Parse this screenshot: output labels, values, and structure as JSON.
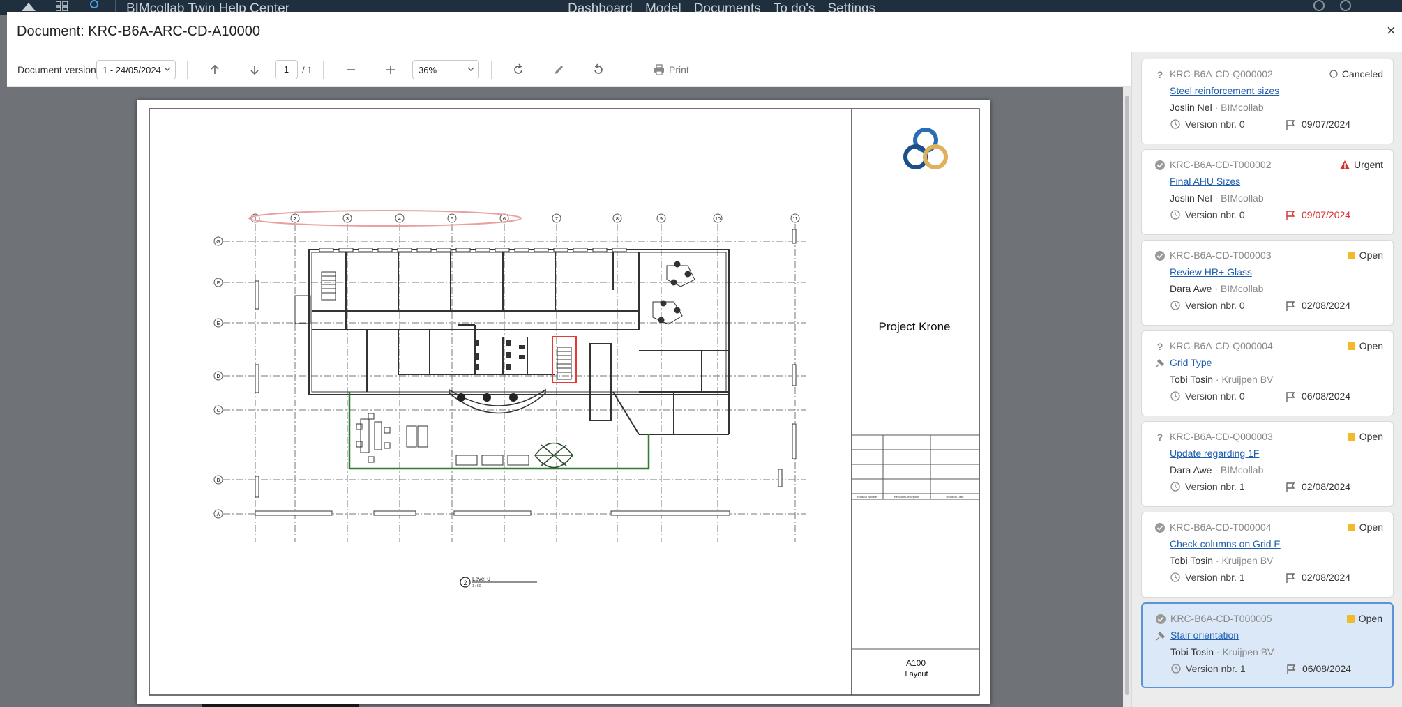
{
  "app": {
    "title": "BIMcollab Twin Help Center",
    "nav": [
      "Dashboard",
      "Model",
      "Documents",
      "To do's",
      "Settings"
    ]
  },
  "modal": {
    "title": "Document: KRC-B6A-ARC-CD-A10000",
    "close_glyph": "×"
  },
  "toolbar": {
    "version_label": "Document version",
    "version_value": "1 - 24/05/2024",
    "page_current": "1",
    "page_total": "/ 1",
    "zoom_value": "36%",
    "print_label": "Print"
  },
  "sheet": {
    "project_name": "Project Krone",
    "sheet_number": "A100",
    "sheet_name": "Layout",
    "view_number": "2",
    "view_title": "Level 0",
    "view_scale": "1 : 50",
    "grid_columns": [
      "1",
      "2",
      "3",
      "4",
      "5",
      "6",
      "7",
      "8",
      "9",
      "10",
      "11"
    ],
    "grid_rows": [
      "G",
      "F",
      "E",
      "D",
      "C",
      "B",
      "A"
    ],
    "revision_headers": [
      "Revision Number",
      "Revision Description",
      "Revision Date"
    ]
  },
  "issues": [
    {
      "code": "KRC-B6A-CD-Q000002",
      "title": "Steel reinforcement sizes",
      "assignee": "Joslin Nel",
      "org": "BIMcollab",
      "version": "Version nbr. 0",
      "due": "09/07/2024",
      "status": "Canceled",
      "type_icon": "question-icon",
      "status_icon": "circle-outline-icon",
      "overdue": false,
      "pinned": false
    },
    {
      "code": "KRC-B6A-CD-T000002",
      "title": "Final AHU Sizes",
      "assignee": "Joslin Nel",
      "org": "BIMcollab",
      "version": "Version nbr. 0",
      "due": "09/07/2024",
      "status": "Urgent",
      "type_icon": "check-circle-icon",
      "status_icon": "warning-triangle-icon",
      "overdue": true,
      "pinned": false
    },
    {
      "code": "KRC-B6A-CD-T000003",
      "title": "Review HR+ Glass",
      "assignee": "Dara Awe",
      "org": "BIMcollab",
      "version": "Version nbr. 0",
      "due": "02/08/2024",
      "status": "Open",
      "type_icon": "check-circle-icon",
      "status_icon": "yellow-square-icon",
      "overdue": false,
      "pinned": false
    },
    {
      "code": "KRC-B6A-CD-Q000004",
      "title": "Grid Type",
      "assignee": "Tobi Tosin",
      "org": "Kruijpen BV",
      "version": "Version nbr. 0",
      "due": "06/08/2024",
      "status": "Open",
      "type_icon": "question-icon",
      "status_icon": "yellow-square-icon",
      "overdue": false,
      "pinned": true
    },
    {
      "code": "KRC-B6A-CD-Q000003",
      "title": "Update regarding 1F",
      "assignee": "Dara Awe",
      "org": "BIMcollab",
      "version": "Version nbr. 1",
      "due": "02/08/2024",
      "status": "Open",
      "type_icon": "question-icon",
      "status_icon": "yellow-square-icon",
      "overdue": false,
      "pinned": false
    },
    {
      "code": "KRC-B6A-CD-T000004",
      "title": "Check columns on Grid E",
      "assignee": "Tobi Tosin",
      "org": "Kruijpen BV",
      "version": "Version nbr. 1",
      "due": "02/08/2024",
      "status": "Open",
      "type_icon": "check-circle-icon",
      "status_icon": "yellow-square-icon",
      "overdue": false,
      "pinned": false
    },
    {
      "code": "KRC-B6A-CD-T000005",
      "title": "Stair orientation",
      "assignee": "Tobi Tosin",
      "org": "Kruijpen BV",
      "version": "Version nbr. 1",
      "due": "06/08/2024",
      "status": "Open",
      "type_icon": "check-circle-icon",
      "status_icon": "yellow-square-icon",
      "overdue": false,
      "pinned": true,
      "selected": true
    }
  ],
  "colors": {
    "link": "#1f5fae",
    "urgent": "#d3312b",
    "open": "#f1b92c",
    "selected_bg": "#dbe8f7",
    "selected_border": "#5a93d6",
    "markup_red": "#e53935",
    "markup_green": "#2e7d32",
    "logo_blue": "#2a6db3",
    "logo_gold": "#e0b15b"
  }
}
